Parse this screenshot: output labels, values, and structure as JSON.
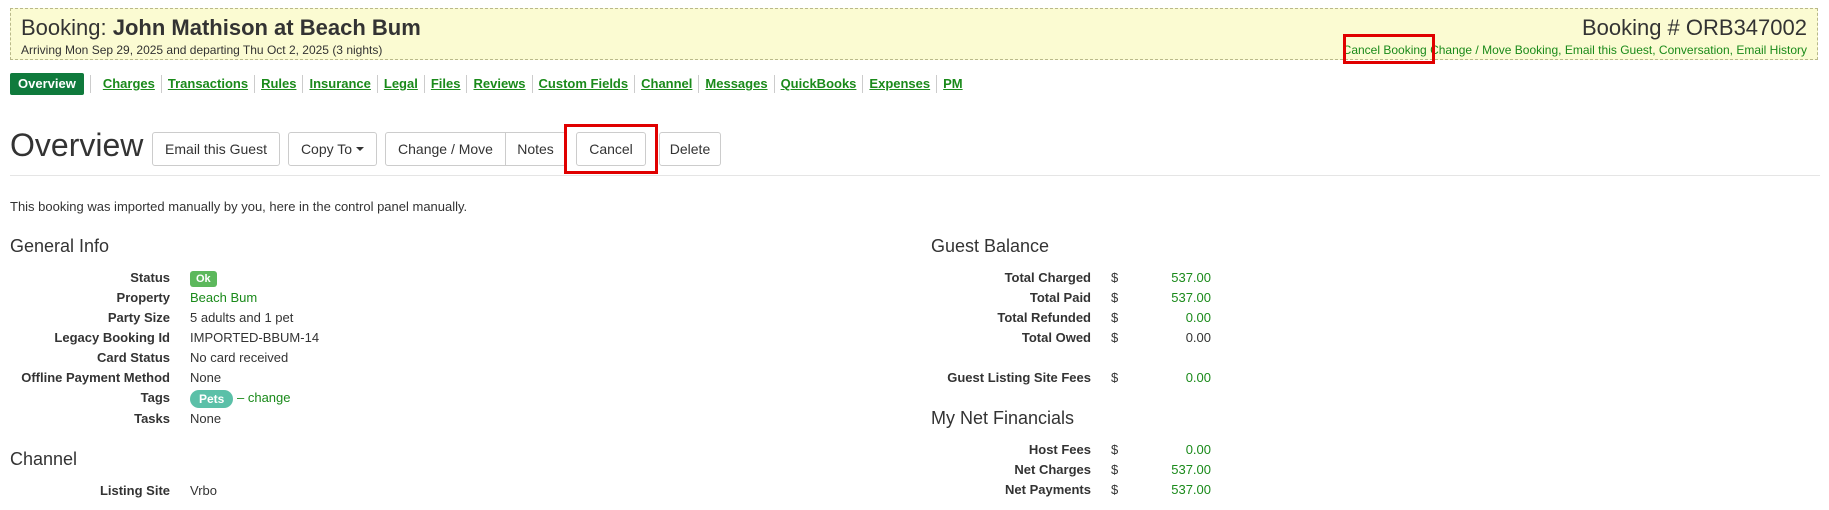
{
  "header": {
    "booking_prefix": "Booking: ",
    "booking_name": "John Mathison at Beach Bum",
    "dates": "Arriving Mon Sep 29, 2025 and departing Thu Oct 2, 2025 (3 nights)",
    "booking_number": "Booking # ORB347002",
    "links": {
      "cancel_booking": "Cancel Booking",
      "change_move": "Change / Move Booking",
      "email_guest": "Email this Guest",
      "conversation": "Conversation",
      "email_history": "Email History",
      "sep": ","
    }
  },
  "tabs": [
    "Overview",
    "Charges",
    "Transactions",
    "Rules",
    "Insurance",
    "Legal",
    "Files",
    "Reviews",
    "Custom Fields",
    "Channel",
    "Messages",
    "QuickBooks",
    "Expenses",
    "PM"
  ],
  "toolbar": {
    "title": "Overview",
    "email_guest": "Email this Guest",
    "copy_to": "Copy To",
    "change_move": "Change / Move",
    "notes": "Notes",
    "cancel": "Cancel",
    "delete": "Delete"
  },
  "intro": "This booking was imported manually by you, here in the control panel manually.",
  "general_info": {
    "heading": "General Info",
    "status": {
      "label": "Status",
      "value": "Ok"
    },
    "property": {
      "label": "Property",
      "value": "Beach Bum"
    },
    "party_size": {
      "label": "Party Size",
      "value": "5 adults and 1 pet"
    },
    "legacy_id": {
      "label": "Legacy Booking Id",
      "value": "IMPORTED-BBUM-14"
    },
    "card_status": {
      "label": "Card Status",
      "value": "No card received"
    },
    "offline_payment": {
      "label": "Offline Payment Method",
      "value": "None"
    },
    "tags": {
      "label": "Tags",
      "value": "Pets",
      "dash": "–",
      "change": "change"
    },
    "tasks": {
      "label": "Tasks",
      "value": "None"
    }
  },
  "channel": {
    "heading": "Channel",
    "listing_site": {
      "label": "Listing Site",
      "value": "Vrbo"
    }
  },
  "guest_balance": {
    "heading": "Guest Balance",
    "currency": "$",
    "rows": [
      {
        "label": "Total Charged",
        "amount": "537.00"
      },
      {
        "label": "Total Paid",
        "amount": "537.00"
      },
      {
        "label": "Total Refunded",
        "amount": "0.00"
      },
      {
        "label": "Total Owed",
        "amount": "0.00"
      },
      {
        "label": "Guest Listing Site Fees",
        "amount": "0.00"
      }
    ]
  },
  "net_financials": {
    "heading": "My Net Financials",
    "currency": "$",
    "rows": [
      {
        "label": "Host Fees",
        "amount": "0.00"
      },
      {
        "label": "Net Charges",
        "amount": "537.00"
      },
      {
        "label": "Net Payments",
        "amount": "537.00"
      }
    ]
  },
  "colors": {
    "accent_green": "#1a8a1a",
    "active_tab": "#0f7a3c",
    "highlight": "#e00000",
    "header_bg": "#fbfbd2"
  }
}
